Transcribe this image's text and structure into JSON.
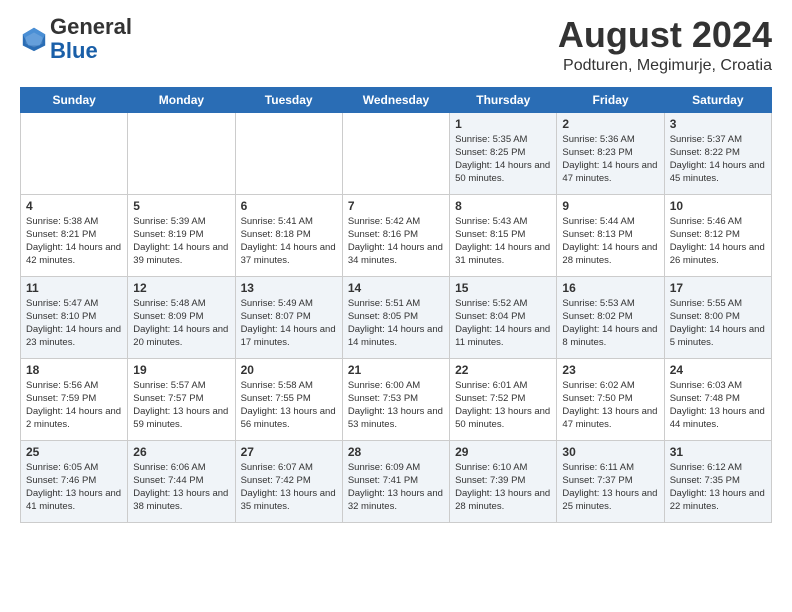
{
  "header": {
    "logo_general": "General",
    "logo_blue": "Blue",
    "month_year": "August 2024",
    "location": "Podturen, Megimurje, Croatia"
  },
  "days_of_week": [
    "Sunday",
    "Monday",
    "Tuesday",
    "Wednesday",
    "Thursday",
    "Friday",
    "Saturday"
  ],
  "weeks": [
    [
      {
        "day": "",
        "info": ""
      },
      {
        "day": "",
        "info": ""
      },
      {
        "day": "",
        "info": ""
      },
      {
        "day": "",
        "info": ""
      },
      {
        "day": "1",
        "info": "Sunrise: 5:35 AM\nSunset: 8:25 PM\nDaylight: 14 hours\nand 50 minutes."
      },
      {
        "day": "2",
        "info": "Sunrise: 5:36 AM\nSunset: 8:23 PM\nDaylight: 14 hours\nand 47 minutes."
      },
      {
        "day": "3",
        "info": "Sunrise: 5:37 AM\nSunset: 8:22 PM\nDaylight: 14 hours\nand 45 minutes."
      }
    ],
    [
      {
        "day": "4",
        "info": "Sunrise: 5:38 AM\nSunset: 8:21 PM\nDaylight: 14 hours\nand 42 minutes."
      },
      {
        "day": "5",
        "info": "Sunrise: 5:39 AM\nSunset: 8:19 PM\nDaylight: 14 hours\nand 39 minutes."
      },
      {
        "day": "6",
        "info": "Sunrise: 5:41 AM\nSunset: 8:18 PM\nDaylight: 14 hours\nand 37 minutes."
      },
      {
        "day": "7",
        "info": "Sunrise: 5:42 AM\nSunset: 8:16 PM\nDaylight: 14 hours\nand 34 minutes."
      },
      {
        "day": "8",
        "info": "Sunrise: 5:43 AM\nSunset: 8:15 PM\nDaylight: 14 hours\nand 31 minutes."
      },
      {
        "day": "9",
        "info": "Sunrise: 5:44 AM\nSunset: 8:13 PM\nDaylight: 14 hours\nand 28 minutes."
      },
      {
        "day": "10",
        "info": "Sunrise: 5:46 AM\nSunset: 8:12 PM\nDaylight: 14 hours\nand 26 minutes."
      }
    ],
    [
      {
        "day": "11",
        "info": "Sunrise: 5:47 AM\nSunset: 8:10 PM\nDaylight: 14 hours\nand 23 minutes."
      },
      {
        "day": "12",
        "info": "Sunrise: 5:48 AM\nSunset: 8:09 PM\nDaylight: 14 hours\nand 20 minutes."
      },
      {
        "day": "13",
        "info": "Sunrise: 5:49 AM\nSunset: 8:07 PM\nDaylight: 14 hours\nand 17 minutes."
      },
      {
        "day": "14",
        "info": "Sunrise: 5:51 AM\nSunset: 8:05 PM\nDaylight: 14 hours\nand 14 minutes."
      },
      {
        "day": "15",
        "info": "Sunrise: 5:52 AM\nSunset: 8:04 PM\nDaylight: 14 hours\nand 11 minutes."
      },
      {
        "day": "16",
        "info": "Sunrise: 5:53 AM\nSunset: 8:02 PM\nDaylight: 14 hours\nand 8 minutes."
      },
      {
        "day": "17",
        "info": "Sunrise: 5:55 AM\nSunset: 8:00 PM\nDaylight: 14 hours\nand 5 minutes."
      }
    ],
    [
      {
        "day": "18",
        "info": "Sunrise: 5:56 AM\nSunset: 7:59 PM\nDaylight: 14 hours\nand 2 minutes."
      },
      {
        "day": "19",
        "info": "Sunrise: 5:57 AM\nSunset: 7:57 PM\nDaylight: 13 hours\nand 59 minutes."
      },
      {
        "day": "20",
        "info": "Sunrise: 5:58 AM\nSunset: 7:55 PM\nDaylight: 13 hours\nand 56 minutes."
      },
      {
        "day": "21",
        "info": "Sunrise: 6:00 AM\nSunset: 7:53 PM\nDaylight: 13 hours\nand 53 minutes."
      },
      {
        "day": "22",
        "info": "Sunrise: 6:01 AM\nSunset: 7:52 PM\nDaylight: 13 hours\nand 50 minutes."
      },
      {
        "day": "23",
        "info": "Sunrise: 6:02 AM\nSunset: 7:50 PM\nDaylight: 13 hours\nand 47 minutes."
      },
      {
        "day": "24",
        "info": "Sunrise: 6:03 AM\nSunset: 7:48 PM\nDaylight: 13 hours\nand 44 minutes."
      }
    ],
    [
      {
        "day": "25",
        "info": "Sunrise: 6:05 AM\nSunset: 7:46 PM\nDaylight: 13 hours\nand 41 minutes."
      },
      {
        "day": "26",
        "info": "Sunrise: 6:06 AM\nSunset: 7:44 PM\nDaylight: 13 hours\nand 38 minutes."
      },
      {
        "day": "27",
        "info": "Sunrise: 6:07 AM\nSunset: 7:42 PM\nDaylight: 13 hours\nand 35 minutes."
      },
      {
        "day": "28",
        "info": "Sunrise: 6:09 AM\nSunset: 7:41 PM\nDaylight: 13 hours\nand 32 minutes."
      },
      {
        "day": "29",
        "info": "Sunrise: 6:10 AM\nSunset: 7:39 PM\nDaylight: 13 hours\nand 28 minutes."
      },
      {
        "day": "30",
        "info": "Sunrise: 6:11 AM\nSunset: 7:37 PM\nDaylight: 13 hours\nand 25 minutes."
      },
      {
        "day": "31",
        "info": "Sunrise: 6:12 AM\nSunset: 7:35 PM\nDaylight: 13 hours\nand 22 minutes."
      }
    ]
  ]
}
